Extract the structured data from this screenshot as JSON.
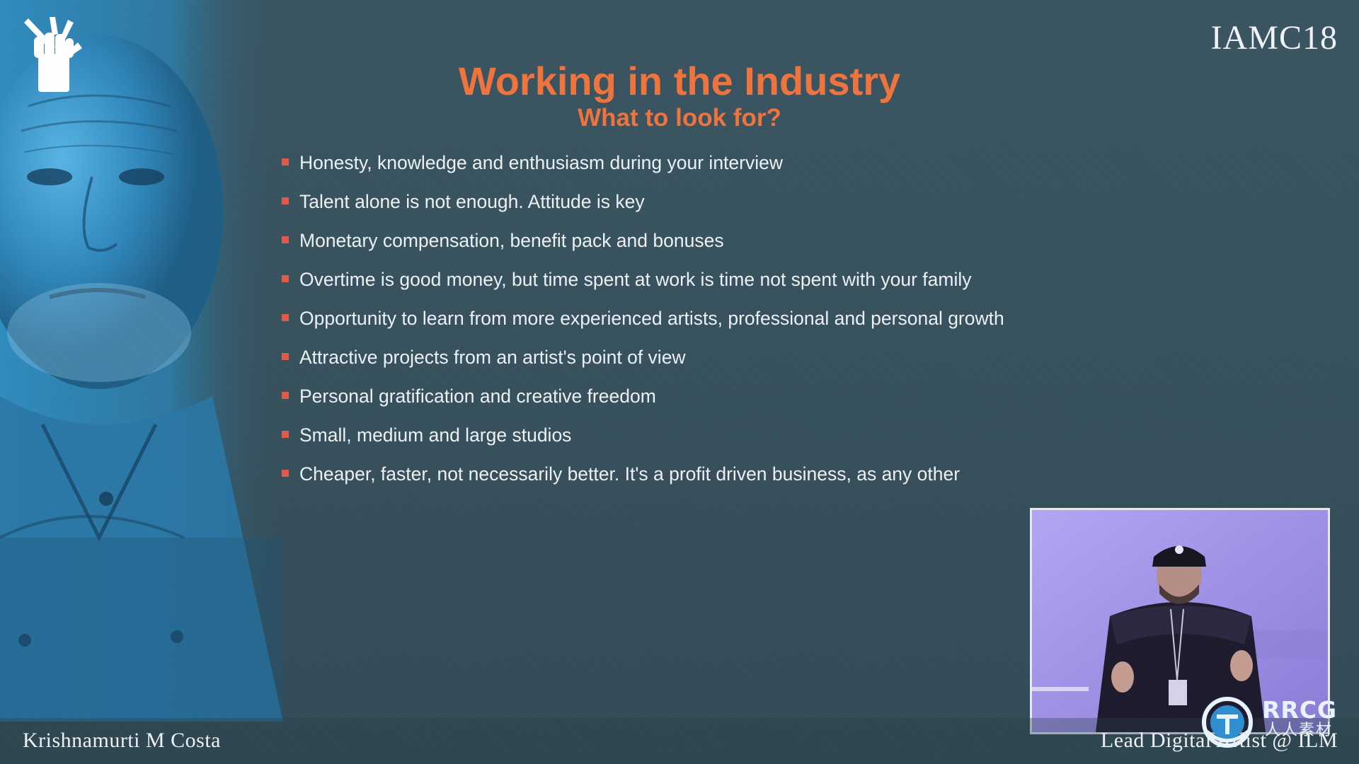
{
  "slide": {
    "brand": "IAMC18",
    "title": "Working in the Industry",
    "subtitle": "What to look for?",
    "bullets": [
      "Honesty, knowledge and enthusiasm during your interview",
      "Talent alone is not enough. Attitude is key",
      "Monetary compensation, benefit pack and bonuses",
      "Overtime is good money, but time spent at work is time not spent with your family",
      "Opportunity to learn from more experienced artists, professional and personal growth",
      "Attractive projects from an artist's point of view",
      "Personal gratification and creative freedom",
      "Small, medium and large studios",
      "Cheaper, faster, not necessarily better. It's a profit driven business, as any other"
    ],
    "footer_left": "Krishnamurti M Costa",
    "footer_right": "Lead Digital Artist @ ILM"
  },
  "watermark": {
    "text": "RRCG",
    "sub": "人人素材"
  },
  "colors": {
    "background": "#37505c",
    "title": "#f0733c",
    "bullet_marker": "#e25a4a",
    "text": "#eef2f4",
    "video_bg": "#9c8ee6"
  },
  "icons": {
    "logo": "fist-logo-icon",
    "bullet": "square-bullet-icon"
  }
}
